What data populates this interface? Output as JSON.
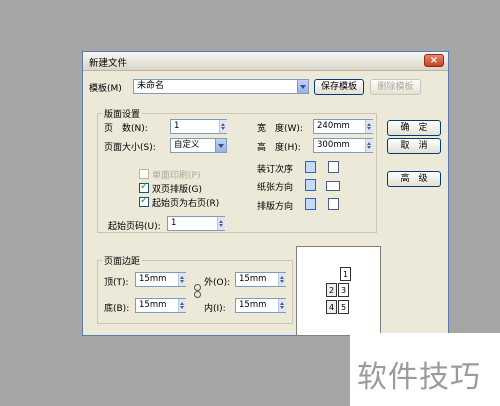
{
  "dialog": {
    "title": "新建文件",
    "close_label": "×"
  },
  "template": {
    "label": "模板(M)",
    "value": "未命名",
    "save_button": "保存模板",
    "delete_button": "删除模板"
  },
  "layout_settings": {
    "group_label": "版面设置",
    "pages_label": "页　数(N):",
    "pages_value": "1",
    "size_label": "页面大小(S):",
    "size_value": "自定义",
    "width_label": "宽　度(W):",
    "width_value": "240mm",
    "height_label": "高　度(H):",
    "height_value": "300mm",
    "single_side_label": "单面印刷(P)",
    "double_page_label": "双页排版(G)",
    "start_right_label": "起始页为右页(R)",
    "binding_label": "装订次序",
    "paper_orientation_label": "纸张方向",
    "typeset_direction_label": "排版方向",
    "start_page_label": "起始页码(U):",
    "start_page_value": "1"
  },
  "buttons": {
    "ok": "确　定",
    "cancel": "取　消",
    "advanced": "高　级"
  },
  "margins": {
    "group_label": "页面边距",
    "top_label": "顶(T):",
    "top_value": "15mm",
    "bottom_label": "底(B):",
    "bottom_value": "15mm",
    "outer_label": "外(O):",
    "outer_value": "15mm",
    "inner_label": "内(I):",
    "inner_value": "15mm"
  },
  "preview": {
    "page_numbers": [
      "1",
      "2",
      "3",
      "4",
      "5"
    ]
  },
  "watermark": {
    "text": "软件技巧"
  }
}
